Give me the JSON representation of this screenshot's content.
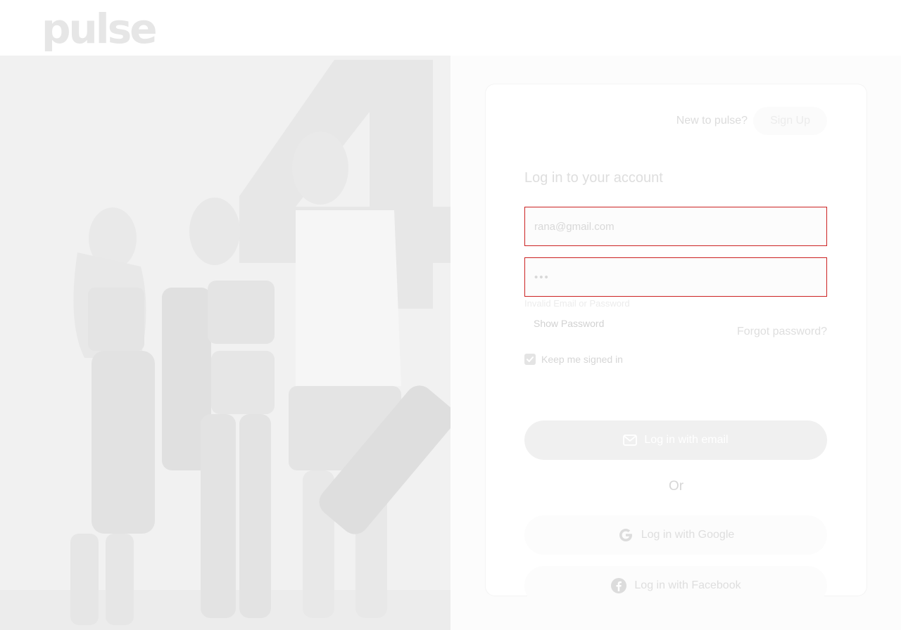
{
  "header": {
    "logo": "pulse"
  },
  "auth": {
    "new_to_text": "New to pulse?",
    "signup_label": "Sign Up",
    "title": "Log in to your account",
    "email_value": "rana@gmail.com",
    "password_value": "•••",
    "error_text": "Invalid Email or Password",
    "show_password_label": "Show Password",
    "forgot_password_label": "Forgot password?",
    "keep_signed_in_label": "Keep me signed in",
    "keep_signed_in_checked": true,
    "email_login_label": "Log in with email",
    "or_text": "Or",
    "google_login_label": "Log in with Google",
    "facebook_login_label": "Log in with Facebook"
  },
  "colors": {
    "error_border": "#cc2222",
    "primary_button": "#f0f0f0"
  }
}
